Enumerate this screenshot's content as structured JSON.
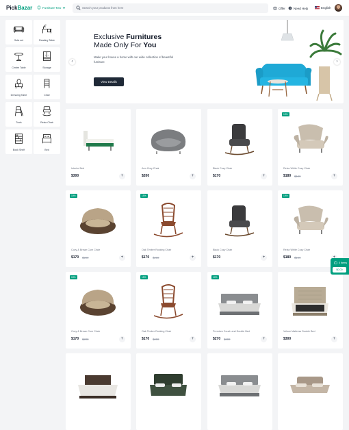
{
  "header": {
    "logo_part1": "Pick",
    "logo_part2": "Bazar",
    "group_select": "Furniture Two",
    "search_placeholder": "Search your products from here",
    "nav_offer": "Offer",
    "nav_help": "Need Help",
    "language": "English"
  },
  "categories": [
    {
      "label": "Sofa set",
      "icon": "sofa-icon"
    },
    {
      "label": "Reading Table",
      "icon": "desk-icon"
    },
    {
      "label": "Centre Table",
      "icon": "round-table-icon"
    },
    {
      "label": "Storage",
      "icon": "cabinet-icon"
    },
    {
      "label": "Dressing Table",
      "icon": "dressing-table-icon"
    },
    {
      "label": "Chair",
      "icon": "chair-icon"
    },
    {
      "label": "Tools",
      "icon": "ladder-icon"
    },
    {
      "label": "Relax Chair",
      "icon": "relax-chair-icon"
    },
    {
      "label": "Book Shelf",
      "icon": "bookshelf-icon"
    },
    {
      "label": "Bed",
      "icon": "bed-icon"
    }
  ],
  "hero": {
    "title_prefix": "Exclusive ",
    "title_bold": "Furnitures",
    "title_line2_prefix": "Made Only For ",
    "title_line2_bold": "You",
    "subtitle": "Make your house a home with our wide collection of beautiful furniture",
    "cta": "View Details"
  },
  "products": [
    {
      "name": "Interior Bed",
      "price": "$300",
      "old": "",
      "badge": "",
      "kind": "bed-slim"
    },
    {
      "name": "Arm Grey Chair",
      "price": "$200",
      "old": "",
      "badge": "",
      "kind": "armchair-grey"
    },
    {
      "name": "Black Cozy Chair",
      "price": "$170",
      "old": "",
      "badge": "",
      "kind": "rocker-black"
    },
    {
      "name": "Relax White Cozy Chair",
      "price": "$180",
      "old": "$199",
      "badge": "10%",
      "kind": "chair-beige"
    },
    {
      "name": "Cozy & Brown Cum Chair",
      "price": "$170",
      "old": "$200",
      "badge": "15%",
      "kind": "round-chair"
    },
    {
      "name": "Oak Timber Rocking Chair",
      "price": "$170",
      "old": "$200",
      "badge": "15%",
      "kind": "rocker-wood"
    },
    {
      "name": "Black Cozy Chair",
      "price": "$170",
      "old": "",
      "badge": "",
      "kind": "rocker-black"
    },
    {
      "name": "Relax White Cozy Chair",
      "price": "$180",
      "old": "$199",
      "badge": "10%",
      "kind": "chair-beige"
    },
    {
      "name": "Cozy & Brown Cum Chair",
      "price": "$170",
      "old": "$200",
      "badge": "15%",
      "kind": "round-chair"
    },
    {
      "name": "Oak Timber Rocking Chair",
      "price": "$170",
      "old": "$200",
      "badge": "15%",
      "kind": "rocker-wood"
    },
    {
      "name": "Premium Couch and Double Bed",
      "price": "$270",
      "old": "$300",
      "badge": "10%",
      "kind": "bed-grey"
    },
    {
      "name": "Veloce Mattress Double Bed",
      "price": "$300",
      "old": "",
      "badge": "",
      "kind": "bed-tufted"
    },
    {
      "name": "",
      "price": "",
      "old": "",
      "badge": "",
      "kind": "bed-dark"
    },
    {
      "name": "",
      "price": "",
      "old": "",
      "badge": "",
      "kind": "bed-green"
    },
    {
      "name": "",
      "price": "",
      "old": "",
      "badge": "",
      "kind": "bed-grey"
    },
    {
      "name": "",
      "price": "",
      "old": "",
      "badge": "",
      "kind": "bed-taupe"
    }
  ],
  "cart": {
    "items": "0 Items",
    "total": "$0.00"
  },
  "colors": {
    "accent": "#009f7f",
    "dark_button": "#1f2937",
    "sofa": "#1fa9d6"
  }
}
